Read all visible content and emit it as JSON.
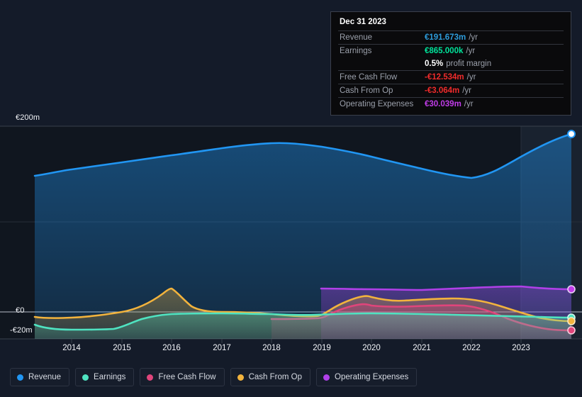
{
  "tooltip": {
    "date": "Dec 31 2023",
    "rows": [
      {
        "label": "Revenue",
        "value": "€191.673m",
        "unit": "/yr",
        "color": "#2d9cdb"
      },
      {
        "label": "Earnings",
        "value": "€865.000k",
        "unit": "/yr",
        "color": "#00e39a"
      },
      {
        "label": "",
        "value": "0.5%",
        "unit": "profit margin",
        "color": "#ffffff"
      },
      {
        "label": "Free Cash Flow",
        "value": "-€12.534m",
        "unit": "/yr",
        "color": "#f02b2b"
      },
      {
        "label": "Cash From Op",
        "value": "-€3.064m",
        "unit": "/yr",
        "color": "#f02b2b"
      },
      {
        "label": "Operating Expenses",
        "value": "€30.039m",
        "unit": "/yr",
        "color": "#c03ce8"
      }
    ]
  },
  "legend": {
    "items": [
      {
        "label": "Revenue",
        "color": "#2196f3"
      },
      {
        "label": "Earnings",
        "color": "#4fe3c1"
      },
      {
        "label": "Free Cash Flow",
        "color": "#e0457b"
      },
      {
        "label": "Cash From Op",
        "color": "#f2b33d"
      },
      {
        "label": "Operating Expenses",
        "color": "#b040e8"
      }
    ]
  },
  "axis": {
    "y_labels": [
      "€200m",
      "€0",
      "-€20m"
    ],
    "x_labels": [
      "2014",
      "2015",
      "2016",
      "2017",
      "2018",
      "2019",
      "2020",
      "2021",
      "2022",
      "2023"
    ]
  },
  "chart_data": {
    "type": "area",
    "title": "",
    "xlabel": "",
    "ylabel": "",
    "ylim": [
      -20,
      200
    ],
    "yticks": [
      200,
      0,
      -20
    ],
    "ytick_labels": [
      "€200m",
      "€0",
      "-€20m"
    ],
    "grid": true,
    "legend_position": "bottom",
    "currency": "EUR",
    "units": "millions",
    "x": [
      "2013.5",
      "2014",
      "2014.5",
      "2015",
      "2015.5",
      "2016",
      "2016.5",
      "2017",
      "2017.5",
      "2018",
      "2018.5",
      "2019",
      "2019.5",
      "2020",
      "2020.5",
      "2021",
      "2021.5",
      "2022",
      "2022.5",
      "2023",
      "2023.5",
      "2024"
    ],
    "x_axis_range": [
      "2013.4",
      "2024.0"
    ],
    "series": [
      {
        "name": "Revenue",
        "color": "#2196f3",
        "values": [
          141,
          144,
          148,
          152,
          154,
          156,
          158,
          162,
          166,
          172,
          176,
          174,
          170,
          168,
          166,
          162,
          158,
          152,
          150,
          160,
          178,
          191.673
        ],
        "last_value": 191.673
      },
      {
        "name": "Earnings",
        "color": "#4fe3c1",
        "values": [
          -14,
          -15,
          -15,
          -15,
          -12,
          -6,
          -3,
          -2,
          -2,
          -2,
          -2,
          -2,
          -2,
          -1,
          -1,
          -1,
          -1,
          -1,
          -1,
          -0.5,
          0.5,
          0.865
        ],
        "last_value": 0.865
      },
      {
        "name": "Free Cash Flow",
        "color": "#e0457b",
        "values": [
          null,
          null,
          null,
          null,
          null,
          null,
          null,
          null,
          null,
          -6,
          -6,
          -5,
          -5,
          -4,
          3,
          5,
          5,
          4,
          2,
          -4,
          -10,
          -12.534
        ],
        "last_value": -12.534
      },
      {
        "name": "Cash From Op",
        "color": "#f2b33d",
        "values": [
          -6,
          -7,
          -6,
          -3,
          2,
          8,
          22,
          4,
          4,
          3,
          0,
          -1,
          -1,
          8,
          13,
          11,
          12,
          12,
          9,
          4,
          -1,
          -3.064
        ],
        "last_value": -3.064
      },
      {
        "name": "Operating Expenses",
        "color": "#b040e8",
        "values": [
          null,
          null,
          null,
          null,
          null,
          null,
          null,
          null,
          null,
          null,
          null,
          25,
          25,
          25,
          25,
          25,
          25,
          26,
          28,
          28,
          30,
          30.039
        ],
        "last_value": 30.039
      }
    ],
    "highlight_region": {
      "from": "2022.75",
      "to": "2024.0",
      "note": "recent/estimate band"
    },
    "selected_point": "Dec 31 2023"
  }
}
